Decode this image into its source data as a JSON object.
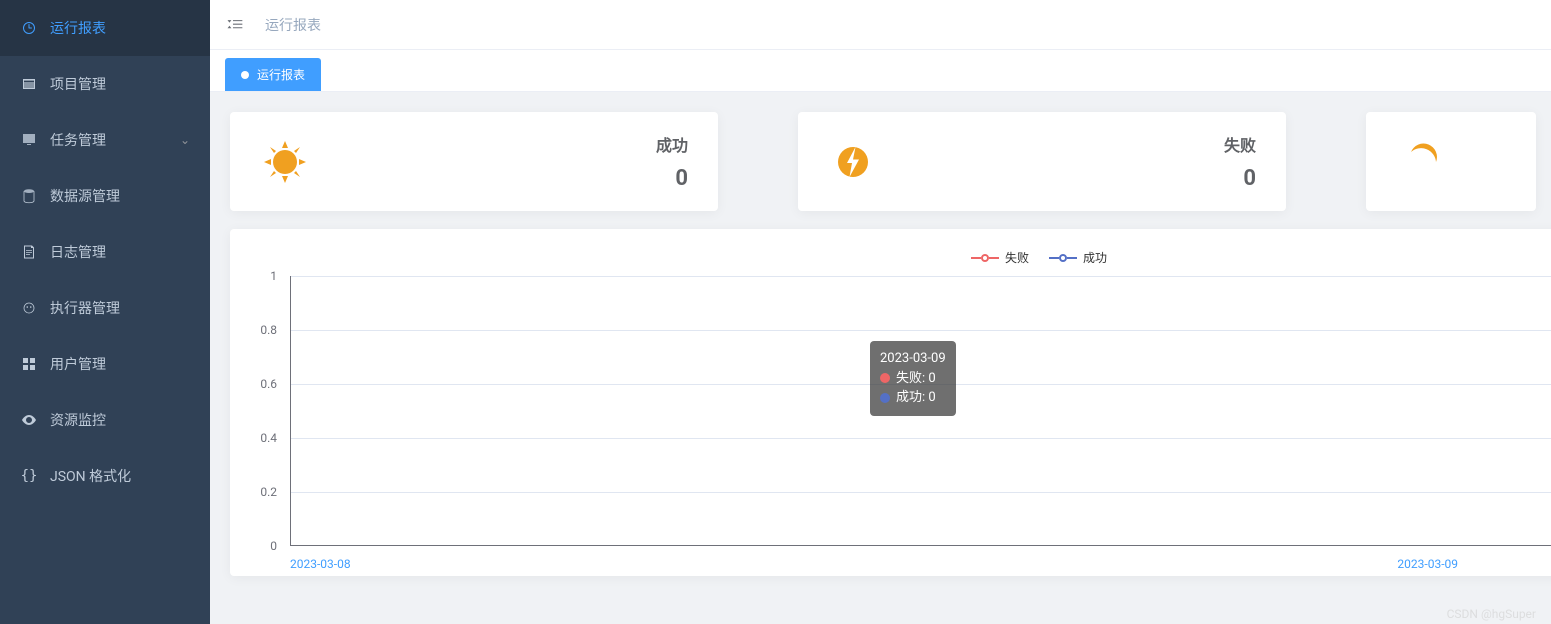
{
  "sidebar": {
    "items": [
      {
        "label": "运行报表",
        "active": true,
        "icon": "dashboard"
      },
      {
        "label": "项目管理",
        "active": false,
        "icon": "box"
      },
      {
        "label": "任务管理",
        "active": false,
        "icon": "monitor",
        "expandable": true
      },
      {
        "label": "数据源管理",
        "active": false,
        "icon": "database"
      },
      {
        "label": "日志管理",
        "active": false,
        "icon": "document"
      },
      {
        "label": "执行器管理",
        "active": false,
        "icon": "robot"
      },
      {
        "label": "用户管理",
        "active": false,
        "icon": "grid"
      },
      {
        "label": "资源监控",
        "active": false,
        "icon": "eye"
      },
      {
        "label": "JSON 格式化",
        "active": false,
        "icon": "braces"
      }
    ]
  },
  "header": {
    "breadcrumb": "运行报表"
  },
  "tabs": {
    "active": "运行报表"
  },
  "cards": [
    {
      "label": "成功",
      "value": "0",
      "icon": "sun"
    },
    {
      "label": "失败",
      "value": "0",
      "icon": "bolt"
    },
    {
      "label": "",
      "value": "",
      "icon": "moon"
    }
  ],
  "chart_data": {
    "type": "line",
    "categories": [
      "2023-03-08",
      "2023-03-09"
    ],
    "series": [
      {
        "name": "失败",
        "color": "#ee6666",
        "values": [
          0,
          0
        ]
      },
      {
        "name": "成功",
        "color": "#5470c6",
        "values": [
          0,
          0
        ]
      }
    ],
    "ylim": [
      0,
      1
    ],
    "yticks": [
      0,
      0.2,
      0.4,
      0.6,
      0.8,
      1
    ],
    "tooltip": {
      "title": "2023-03-09",
      "rows": [
        {
          "label": "失败",
          "value": "0",
          "color": "#ee6666"
        },
        {
          "label": "成功",
          "value": "0",
          "color": "#5470c6"
        }
      ]
    }
  },
  "watermark": "CSDN @hgSuper"
}
